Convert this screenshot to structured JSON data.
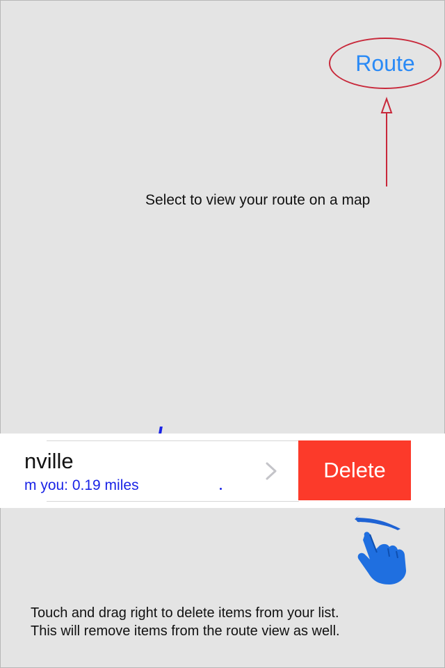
{
  "header": {
    "route_label": "Route"
  },
  "annotations": {
    "route_hint": "Select to view your route on a map",
    "delete_hint_line1": "Touch and drag right to delete items from your list.",
    "delete_hint_line2": "This will remove items from the route view as well."
  },
  "list_item": {
    "title": "nville",
    "distance": "m you: 0.19 miles",
    "delete_label": "Delete"
  },
  "colors": {
    "accent": "#2a8af6",
    "delete": "#fc3a2a",
    "highlight": "#c8283a",
    "distance_text": "#1a24e6",
    "background": "#e4e4e4"
  },
  "icons": {
    "chevron": "chevron-right-icon",
    "hand": "swipe-hand-icon",
    "arrow": "arrow-up-icon"
  }
}
